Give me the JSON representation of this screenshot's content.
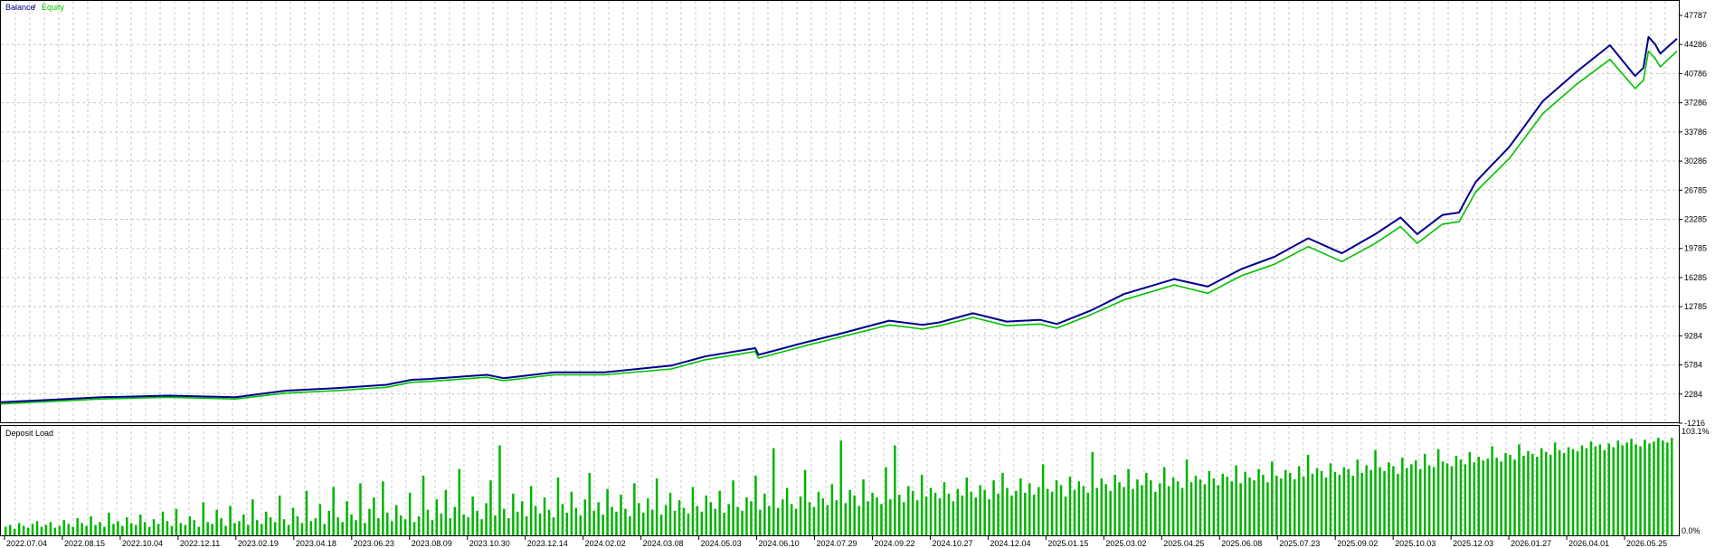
{
  "chart_data": [
    {
      "type": "line",
      "legend": {
        "balance_label": "Balance",
        "separator": " / ",
        "equity_label": "Equity",
        "placement": "top-left"
      },
      "colors": {
        "balance": "#00008b",
        "equity": "#00c000",
        "grid": "#c8c8c8",
        "axis": "#000000"
      },
      "grid": true,
      "y_ticks": [
        "47787",
        "44286",
        "40786",
        "37286",
        "33786",
        "30286",
        "26785",
        "23285",
        "19785",
        "16285",
        "12785",
        "9284",
        "5784",
        "2284",
        "-1216"
      ],
      "ylim": [
        -1216,
        47787
      ],
      "x_ticks": [
        "2022.07.04",
        "2022.08.15",
        "2022.10.04",
        "2022.12.11",
        "2023.02.19",
        "2023.04.18",
        "2023.06.23",
        "2023.08.09",
        "2023.10.30",
        "2023.12.14",
        "2024.02.02",
        "2024.03.08",
        "2024.05.03",
        "2024.06.10",
        "2024.07.29",
        "2024.09.22",
        "2024.10.27",
        "2024.12.04",
        "2025.01.15",
        "2025.03.02",
        "2025.04.25",
        "2025.06.08",
        "2025.07.23",
        "2025.09.02",
        "2025.10.03",
        "2025.12.03",
        "2026.01.27",
        "2026.04.01",
        "2026.05.25"
      ],
      "series": [
        {
          "name": "Balance",
          "x": [
            0,
            0.03,
            0.06,
            0.1,
            0.14,
            0.17,
            0.2,
            0.23,
            0.245,
            0.255,
            0.29,
            0.3,
            0.33,
            0.36,
            0.4,
            0.42,
            0.45,
            0.452,
            0.48,
            0.5,
            0.53,
            0.55,
            0.56,
            0.58,
            0.6,
            0.62,
            0.63,
            0.65,
            0.67,
            0.7,
            0.72,
            0.74,
            0.76,
            0.78,
            0.8,
            0.82,
            0.835,
            0.845,
            0.86,
            0.87,
            0.875,
            0.88,
            0.9,
            0.92,
            0.94,
            0.96,
            0.975,
            0.98,
            0.983,
            0.987,
            0.99,
            1
          ],
          "values": [
            1300,
            1600,
            1900,
            2100,
            1900,
            2700,
            3000,
            3400,
            4000,
            4100,
            4600,
            4200,
            4900,
            4900,
            5700,
            6800,
            7800,
            7000,
            8500,
            9500,
            11100,
            10600,
            10900,
            12000,
            11000,
            11200,
            10700,
            12300,
            14300,
            16100,
            15200,
            17300,
            18800,
            21000,
            19200,
            21500,
            23500,
            21500,
            23800,
            24100,
            26000,
            27800,
            32000,
            37500,
            41000,
            44200,
            40500,
            41500,
            45200,
            44300,
            43200,
            45000
          ]
        },
        {
          "name": "Equity",
          "x": [
            0,
            0.03,
            0.06,
            0.1,
            0.14,
            0.17,
            0.2,
            0.23,
            0.245,
            0.255,
            0.29,
            0.3,
            0.33,
            0.36,
            0.4,
            0.42,
            0.45,
            0.452,
            0.48,
            0.5,
            0.53,
            0.55,
            0.56,
            0.58,
            0.6,
            0.62,
            0.63,
            0.65,
            0.67,
            0.7,
            0.72,
            0.74,
            0.76,
            0.78,
            0.8,
            0.82,
            0.835,
            0.845,
            0.86,
            0.87,
            0.875,
            0.88,
            0.9,
            0.92,
            0.94,
            0.96,
            0.975,
            0.98,
            0.983,
            0.987,
            0.99,
            1
          ],
          "values": [
            1100,
            1400,
            1700,
            1900,
            1700,
            2400,
            2700,
            3100,
            3700,
            3800,
            4300,
            3900,
            4600,
            4600,
            5300,
            6400,
            7400,
            6600,
            8100,
            9100,
            10600,
            10100,
            10500,
            11500,
            10500,
            10700,
            10200,
            11800,
            13600,
            15400,
            14400,
            16500,
            17900,
            20000,
            18200,
            20400,
            22400,
            20400,
            22700,
            23000,
            24800,
            26600,
            30600,
            36000,
            39500,
            42500,
            39000,
            40000,
            43500,
            42600,
            41600,
            43500
          ]
        }
      ]
    },
    {
      "type": "bar",
      "title": "Deposit Load",
      "y_ticks": [
        "103.1%",
        "0.0%"
      ],
      "ylim": [
        0,
        103.1
      ],
      "colors": {
        "bar": "#00b400"
      },
      "values": [
        9,
        11,
        7,
        13,
        10,
        8,
        12,
        15,
        9,
        11,
        14,
        8,
        10,
        16,
        12,
        9,
        18,
        13,
        10,
        20,
        11,
        14,
        9,
        24,
        12,
        15,
        10,
        19,
        13,
        11,
        22,
        14,
        9,
        17,
        12,
        25,
        15,
        10,
        28,
        13,
        11,
        20,
        16,
        9,
        35,
        14,
        12,
        27,
        18,
        10,
        31,
        13,
        15,
        22,
        11,
        38,
        16,
        12,
        25,
        19,
        14,
        42,
        17,
        11,
        29,
        20,
        13,
        47,
        15,
        18,
        33,
        12,
        26,
        51,
        19,
        14,
        36,
        22,
        16,
        55,
        13,
        28,
        40,
        18,
        57,
        24,
        15,
        32,
        21,
        17,
        45,
        14,
        20,
        63,
        27,
        16,
        38,
        23,
        48,
        18,
        30,
        70,
        22,
        19,
        41,
        26,
        17,
        34,
        58,
        21,
        95,
        28,
        18,
        44,
        25,
        36,
        20,
        52,
        31,
        23,
        40,
        27,
        19,
        61,
        33,
        24,
        46,
        29,
        21,
        38,
        66,
        26,
        35,
        22,
        49,
        30,
        25,
        43,
        28,
        20,
        55,
        34,
        24,
        39,
        27,
        60,
        22,
        32,
        45,
        26,
        37,
        29,
        23,
        51,
        31,
        25,
        42,
        35,
        28,
        47,
        24,
        33,
        58,
        30,
        26,
        40,
        36,
        63,
        27,
        44,
        31,
        92,
        29,
        38,
        50,
        33,
        28,
        41,
        69,
        35,
        30,
        46,
        39,
        32,
        54,
        37,
        100,
        34,
        48,
        42,
        31,
        59,
        36,
        45,
        40,
        33,
        72,
        38,
        95,
        43,
        35,
        52,
        47,
        37,
        64,
        41,
        50,
        45,
        39,
        56,
        44,
        36,
        49,
        42,
        61,
        46,
        40,
        53,
        48,
        38,
        58,
        44,
        66,
        50,
        42,
        47,
        60,
        45,
        55,
        43,
        51,
        75,
        49,
        46,
        58,
        53,
        41,
        62,
        48,
        57,
        52,
        45,
        88,
        50,
        60,
        54,
        47,
        64,
        56,
        51,
        70,
        49,
        59,
        53,
        66,
        58,
        46,
        55,
        72,
        52,
        61,
        57,
        50,
        80,
        56,
        63,
        59,
        54,
        68,
        60,
        53,
        65,
        62,
        57,
        74,
        55,
        67,
        61,
        58,
        70,
        64,
        56,
        78,
        63,
        60,
        69,
        66,
        59,
        73,
        62,
        85,
        65,
        71,
        68,
        61,
        76,
        67,
        64,
        72,
        70,
        63,
        80,
        66,
        74,
        69,
        90,
        72,
        68,
        77,
        73,
        65,
        82,
        71,
        75,
        79,
        70,
        86,
        74,
        72,
        91,
        78,
        76,
        73,
        84,
        80,
        75,
        88,
        77,
        83,
        79,
        81,
        94,
        82,
        78,
        87,
        85,
        80,
        96,
        84,
        89,
        86,
        83,
        92,
        88,
        85,
        98,
        90,
        87,
        93,
        91,
        89,
        95,
        92,
        99,
        94,
        96,
        90,
        97,
        93,
        100,
        95,
        98,
        102,
        96,
        94,
        101,
        97,
        99,
        103,
        100,
        98,
        103
      ]
    }
  ]
}
